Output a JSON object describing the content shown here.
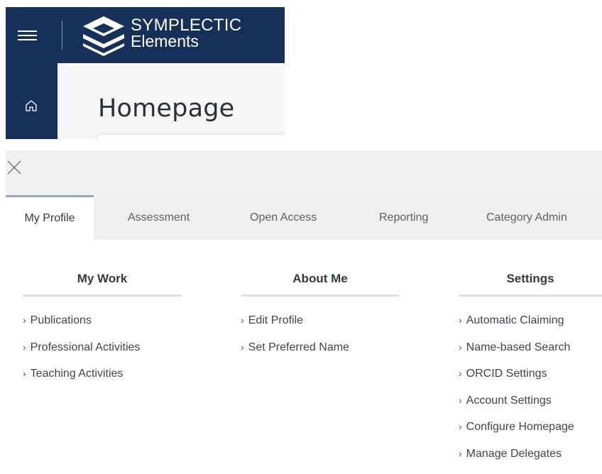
{
  "brand": {
    "line1": "SYMPLECTIC",
    "line2": "Elements",
    "color": "#17305a"
  },
  "header": {
    "menu_icon": "hamburger-icon",
    "home_icon": "home-icon",
    "page_title": "Homepage"
  },
  "menu_panel": {
    "close_icon": "close-icon",
    "tabs": [
      {
        "label": "My Profile",
        "active": true
      },
      {
        "label": "Assessment",
        "active": false
      },
      {
        "label": "Open Access",
        "active": false
      },
      {
        "label": "Reporting",
        "active": false
      },
      {
        "label": "Category Admin",
        "active": false
      }
    ],
    "columns": [
      {
        "title": "My Work",
        "items": [
          "Publications",
          "Professional Activities",
          "Teaching Activities"
        ]
      },
      {
        "title": "About Me",
        "items": [
          "Edit Profile",
          "Set Preferred Name"
        ]
      },
      {
        "title": "Settings",
        "items": [
          "Automatic Claiming",
          "Name-based Search",
          "ORCID Settings",
          "Account Settings",
          "Configure Homepage",
          "Manage Delegates"
        ]
      }
    ],
    "chevron": "›"
  }
}
